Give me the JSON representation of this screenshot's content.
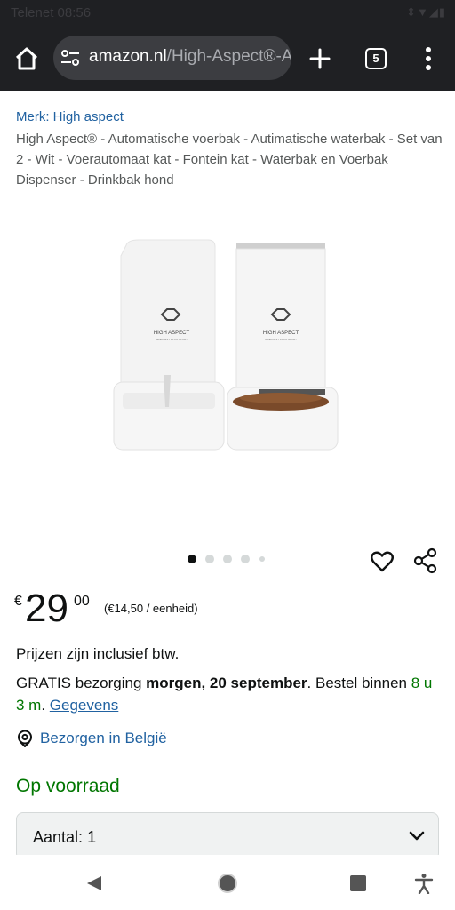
{
  "status_bar": {
    "carrier_time": "Telenet 08:56",
    "icons": [
      "vibrate-icon",
      "wifi-icon",
      "signal-icon",
      "battery-icon"
    ]
  },
  "browser": {
    "url_host": "amazon.nl",
    "url_path": "/High-Aspect®-Automatische",
    "tab_count": "5",
    "icons": [
      "home-icon",
      "site-settings-icon",
      "new-tab-icon",
      "menu-icon"
    ]
  },
  "product": {
    "brand_link": "Merk: High aspect",
    "title": "High Aspect® - Automatische voerbak - Autimatische waterbak - Set van 2 - Wit - Voerautomaat kat - Fontein kat - Waterbak en Voerbak Dispenser - Drinkbak hond",
    "image_logo_text": "HIGH ASPECT",
    "image_logo_subtext": "GREATEST IN US SPORT",
    "image_count": 5,
    "active_image_index": 0
  },
  "price": {
    "currency": "€",
    "whole": "29",
    "fraction": "00",
    "unit_price": "(€14,50 / eenheid)"
  },
  "info": {
    "vat_text": "Prijzen zijn inclusief btw.",
    "delivery_prefix": "GRATIS bezorging ",
    "delivery_date": "morgen, 20 september",
    "delivery_middle": ". Bestel binnen ",
    "delivery_countdown": "8 u 3 m",
    "delivery_suffix": ". ",
    "details_link": "Gegevens",
    "location": "Bezorgen in België",
    "stock": "Op voorraad"
  },
  "quantity": {
    "label": "Aantal:",
    "value": "1"
  },
  "colors": {
    "link": "#2162a1",
    "in_stock": "#007600",
    "toolbar": "#1f2023"
  }
}
